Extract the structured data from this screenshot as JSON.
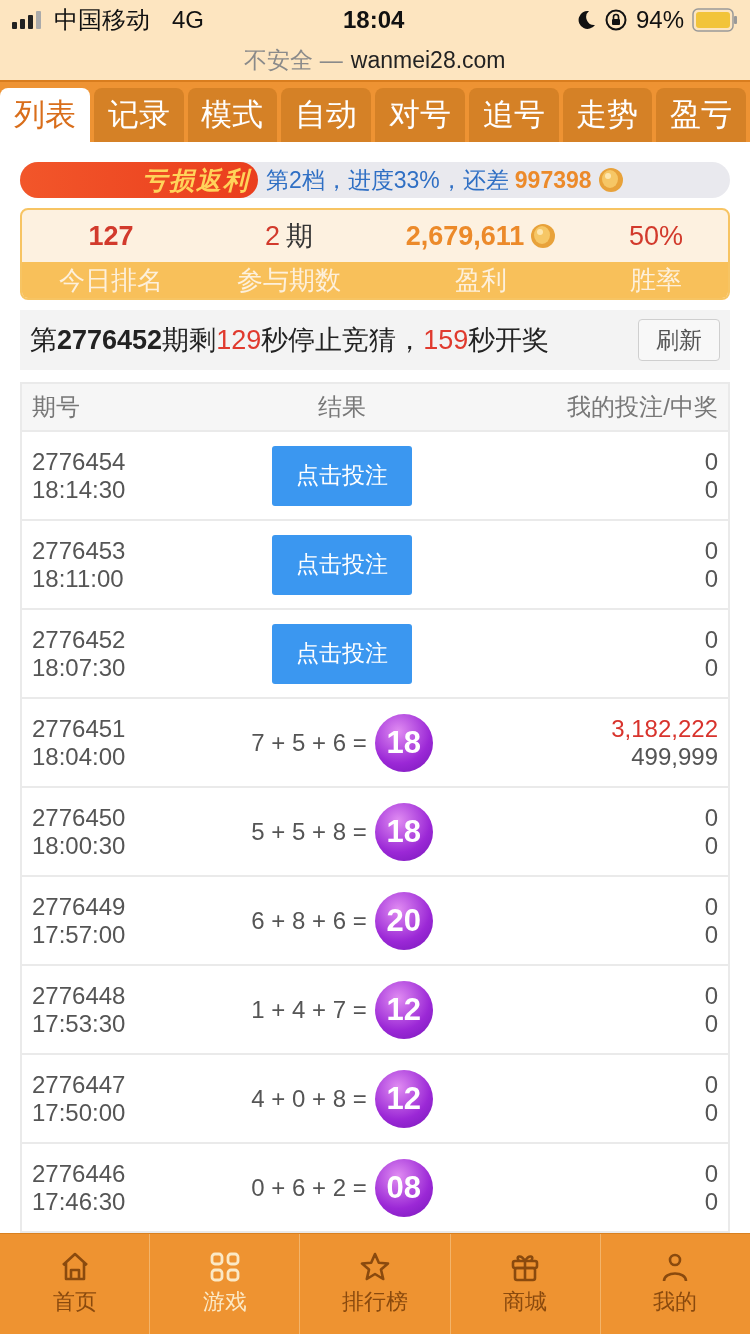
{
  "status_bar": {
    "carrier": "中国移动",
    "network": "4G",
    "time": "18:04",
    "battery": "94%"
  },
  "address_bar": {
    "security": "不安全 —",
    "domain": "wanmei28.com"
  },
  "tabs": [
    {
      "label": "列表",
      "selected": true
    },
    {
      "label": "记录",
      "selected": false
    },
    {
      "label": "模式",
      "selected": false
    },
    {
      "label": "自动",
      "selected": false
    },
    {
      "label": "对号",
      "selected": false
    },
    {
      "label": "追号",
      "selected": false
    },
    {
      "label": "走势",
      "selected": false
    },
    {
      "label": "盈亏",
      "selected": false
    }
  ],
  "rebate": {
    "badge": "亏损返利",
    "progress_text": "第2档，进度33%，还差",
    "amount": "997398"
  },
  "stats": [
    {
      "kind": "rank",
      "value": "127",
      "label": "今日排名"
    },
    {
      "kind": "count",
      "value": "2",
      "unit": "期",
      "label": "参与期数"
    },
    {
      "kind": "profit",
      "value": "2,679,611",
      "label": "盈利"
    },
    {
      "kind": "rate",
      "value": "50%",
      "label": "胜率"
    }
  ],
  "countdown": {
    "parts": [
      {
        "kind": "plain",
        "text": "第"
      },
      {
        "kind": "bold",
        "text": "2776452"
      },
      {
        "kind": "plain",
        "text": "期剩"
      },
      {
        "kind": "red",
        "text": "129"
      },
      {
        "kind": "plain",
        "text": "秒停止竞猜，"
      },
      {
        "kind": "red",
        "text": "159"
      },
      {
        "kind": "plain",
        "text": "秒开奖"
      }
    ],
    "button": "刷新"
  },
  "table": {
    "columns": [
      "期号",
      "结果",
      "我的投注/中奖"
    ],
    "rows": [
      {
        "period": "2776454",
        "time": "18:14:30",
        "kind": "bet",
        "button": "点击投注",
        "bet": "0",
        "win": "0",
        "won": false
      },
      {
        "period": "2776453",
        "time": "18:11:00",
        "kind": "bet",
        "button": "点击投注",
        "bet": "0",
        "win": "0",
        "won": false
      },
      {
        "period": "2776452",
        "time": "18:07:30",
        "kind": "bet",
        "button": "点击投注",
        "bet": "0",
        "win": "0",
        "won": false
      },
      {
        "period": "2776451",
        "time": "18:04:00",
        "kind": "result",
        "formula": "7 + 5 + 6 =",
        "ball": "18",
        "bet": "3,182,222",
        "win": "499,999",
        "won": true
      },
      {
        "period": "2776450",
        "time": "18:00:30",
        "kind": "result",
        "formula": "5 + 5 + 8 =",
        "ball": "18",
        "bet": "0",
        "win": "0",
        "won": false
      },
      {
        "period": "2776449",
        "time": "17:57:00",
        "kind": "result",
        "formula": "6 + 8 + 6 =",
        "ball": "20",
        "bet": "0",
        "win": "0",
        "won": false
      },
      {
        "period": "2776448",
        "time": "17:53:30",
        "kind": "result",
        "formula": "1 + 4 + 7 =",
        "ball": "12",
        "bet": "0",
        "win": "0",
        "won": false
      },
      {
        "period": "2776447",
        "time": "17:50:00",
        "kind": "result",
        "formula": "4 + 0 + 8 =",
        "ball": "12",
        "bet": "0",
        "win": "0",
        "won": false
      },
      {
        "period": "2776446",
        "time": "17:46:30",
        "kind": "result",
        "formula": "0 + 6 + 2 =",
        "ball": "08",
        "bet": "0",
        "win": "0",
        "won": false
      }
    ]
  },
  "bottom_nav": [
    {
      "kind": "home",
      "label": "首页",
      "selected": false
    },
    {
      "kind": "grid",
      "label": "游戏",
      "selected": true
    },
    {
      "kind": "star",
      "label": "排行榜",
      "selected": false
    },
    {
      "kind": "gift",
      "label": "商城",
      "selected": false
    },
    {
      "kind": "person",
      "label": "我的",
      "selected": false
    }
  ]
}
